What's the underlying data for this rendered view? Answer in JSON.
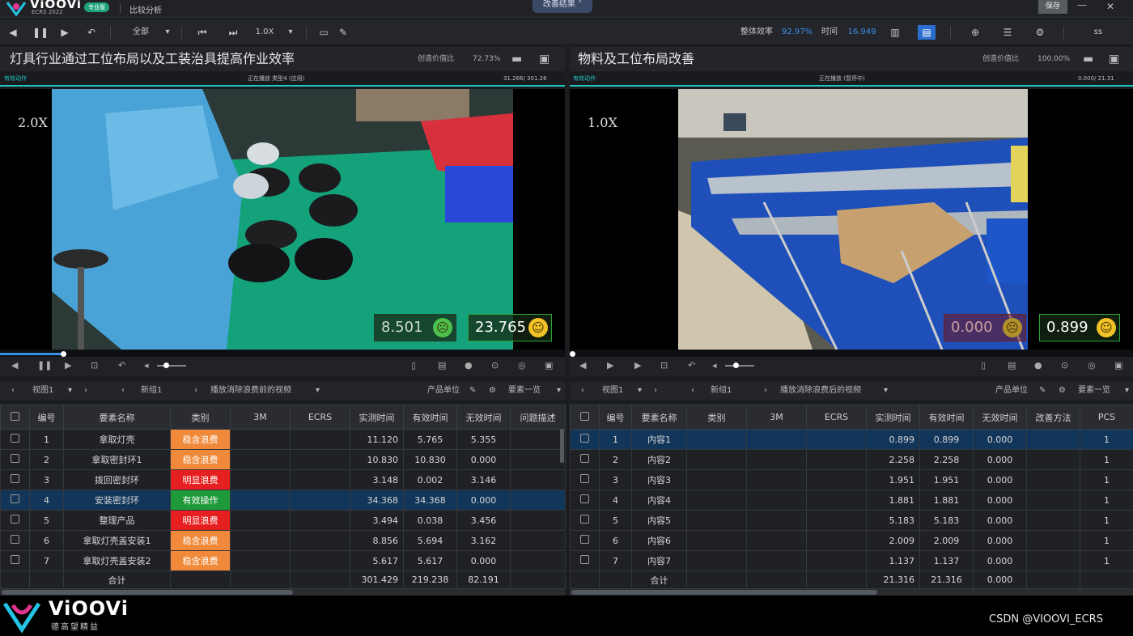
{
  "app": {
    "logo_name": "ViOOVi",
    "logo_sub": "ECRS 2022",
    "badge": "专业版",
    "module_title": "比较分析",
    "improve_result": "改善结果",
    "save_label": "保存",
    "minimize": "—",
    "close": "✕"
  },
  "toolbar": {
    "scope": "全部",
    "speed": "1.0X",
    "efficiency_label": "整体效率",
    "efficiency_value": "92.97%",
    "time_label": "时间",
    "time_value": "16.949",
    "user": "ss"
  },
  "left": {
    "title": "灯具行业通过工位布局以及工装治具提高作业效率",
    "value_ratio_label": "创造价值比",
    "value_ratio": "72.73%",
    "subbar_tag": "有效动作",
    "subbar_status": "正在播放 类型4 (应用)",
    "subbar_time": "31.266/ 301.26",
    "speed": "2.0X",
    "time_gray": "8.501",
    "time_green": "23.765",
    "view": "视图1",
    "group": "新组1",
    "video_name": "播放消除浪费前的视频",
    "unit": "产品单位",
    "element_list": "要素一览",
    "columns": [
      "编号",
      "要素名称",
      "类别",
      "3M",
      "ECRS",
      "实测时间",
      "有效时间",
      "无效时间",
      "问题描述"
    ],
    "rows": [
      {
        "no": "1",
        "name": "拿取灯壳",
        "cat": "稳含浪费",
        "cat_color": "#f08a3a",
        "measured": "11.120",
        "valid": "5.765",
        "invalid": "5.355"
      },
      {
        "no": "2",
        "name": "拿取密封环1",
        "cat": "稳含浪费",
        "cat_color": "#f08a3a",
        "measured": "10.830",
        "valid": "10.830",
        "invalid": "0.000"
      },
      {
        "no": "3",
        "name": "拨回密封环",
        "cat": "明显浪费",
        "cat_color": "#e62020",
        "measured": "3.148",
        "valid": "0.002",
        "invalid": "3.146"
      },
      {
        "no": "4",
        "name": "安装密封环",
        "cat": "有效操作",
        "cat_color": "#1f9a3a",
        "measured": "34.368",
        "valid": "34.368",
        "invalid": "0.000"
      },
      {
        "no": "5",
        "name": "整理产品",
        "cat": "明显浪费",
        "cat_color": "#e62020",
        "measured": "3.494",
        "valid": "0.038",
        "invalid": "3.456"
      },
      {
        "no": "6",
        "name": "拿取灯壳盖安装1",
        "cat": "稳含浪费",
        "cat_color": "#f08a3a",
        "measured": "8.856",
        "valid": "5.694",
        "invalid": "3.162"
      },
      {
        "no": "7",
        "name": "拿取灯壳盖安装2",
        "cat": "稳含浪费",
        "cat_color": "#f08a3a",
        "measured": "5.617",
        "valid": "5.617",
        "invalid": "0.000"
      }
    ],
    "total": {
      "label": "合计",
      "measured": "301.429",
      "valid": "219.238",
      "invalid": "82.191"
    }
  },
  "right": {
    "title": "物料及工位布局改善",
    "value_ratio_label": "创造价值比",
    "value_ratio": "100.00%",
    "subbar_tag": "有效动作",
    "subbar_status": "正在播放 (暂停中)",
    "subbar_time": "0.000/ 21.31",
    "speed": "1.0X",
    "time_gray": "0.000",
    "time_green": "0.899",
    "view": "视图1",
    "group": "新组1",
    "video_name": "播放消除浪费后的视频",
    "unit": "产品单位",
    "element_list": "要素一览",
    "columns": [
      "编号",
      "要素名称",
      "类别",
      "3M",
      "ECRS",
      "实测时间",
      "有效时间",
      "无效时间",
      "改善方法",
      "PCS"
    ],
    "rows": [
      {
        "no": "1",
        "name": "内容1",
        "measured": "0.899",
        "valid": "0.899",
        "invalid": "0.000",
        "pcs": "1"
      },
      {
        "no": "2",
        "name": "内容2",
        "measured": "2.258",
        "valid": "2.258",
        "invalid": "0.000",
        "pcs": "1"
      },
      {
        "no": "3",
        "name": "内容3",
        "measured": "1.951",
        "valid": "1.951",
        "invalid": "0.000",
        "pcs": "1"
      },
      {
        "no": "4",
        "name": "内容4",
        "measured": "1.881",
        "valid": "1.881",
        "invalid": "0.000",
        "pcs": "1"
      },
      {
        "no": "5",
        "name": "内容5",
        "measured": "5.183",
        "valid": "5.183",
        "invalid": "0.000",
        "pcs": "1"
      },
      {
        "no": "6",
        "name": "内容6",
        "measured": "2.009",
        "valid": "2.009",
        "invalid": "0.000",
        "pcs": "1"
      },
      {
        "no": "7",
        "name": "内容7",
        "measured": "1.137",
        "valid": "1.137",
        "invalid": "0.000",
        "pcs": "1"
      }
    ],
    "total": {
      "label": "合计",
      "measured": "21.316",
      "valid": "21.316",
      "invalid": "0.000"
    }
  },
  "footer": {
    "brand": "ViOOVi",
    "slogan": "德高望精益",
    "watermark": "CSDN @VIOOVI_ECRS"
  }
}
